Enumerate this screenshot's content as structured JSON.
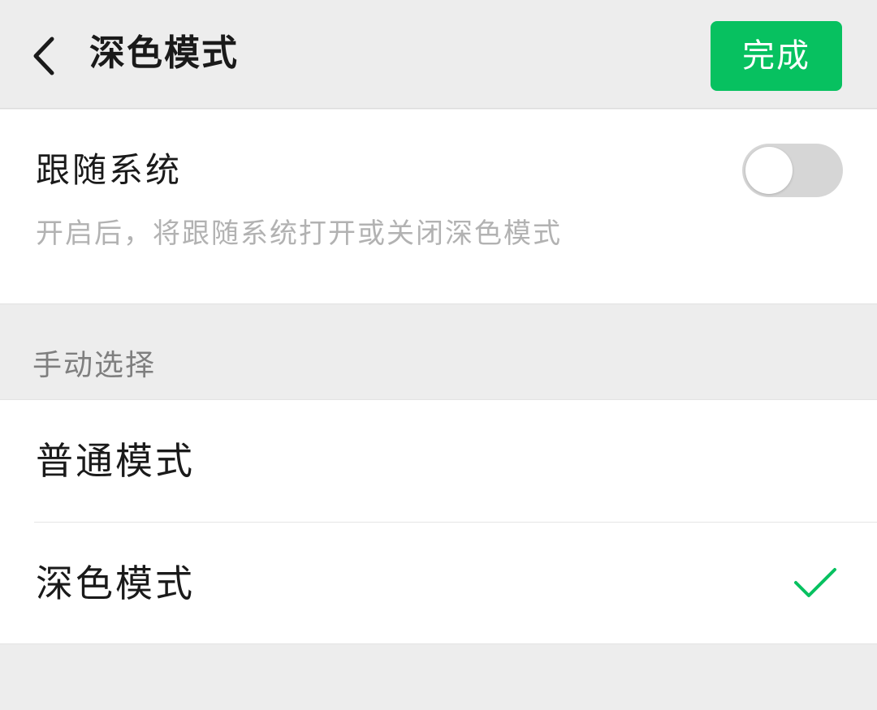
{
  "header": {
    "title": "深色模式",
    "done_label": "完成",
    "back_icon": "chevron-left-icon"
  },
  "follow_system": {
    "label": "跟随系统",
    "description": "开启后，将跟随系统打开或关闭深色模式",
    "enabled": false
  },
  "manual": {
    "section_label": "手动选择",
    "options": [
      {
        "label": "普通模式",
        "selected": false
      },
      {
        "label": "深色模式",
        "selected": true
      }
    ],
    "selected_icon": "checkmark-icon"
  },
  "colors": {
    "accent": "#07c160",
    "background": "#ededed",
    "card": "#ffffff",
    "secondary_text": "#b2b2b2",
    "toggle_off": "#d6d6d6"
  }
}
